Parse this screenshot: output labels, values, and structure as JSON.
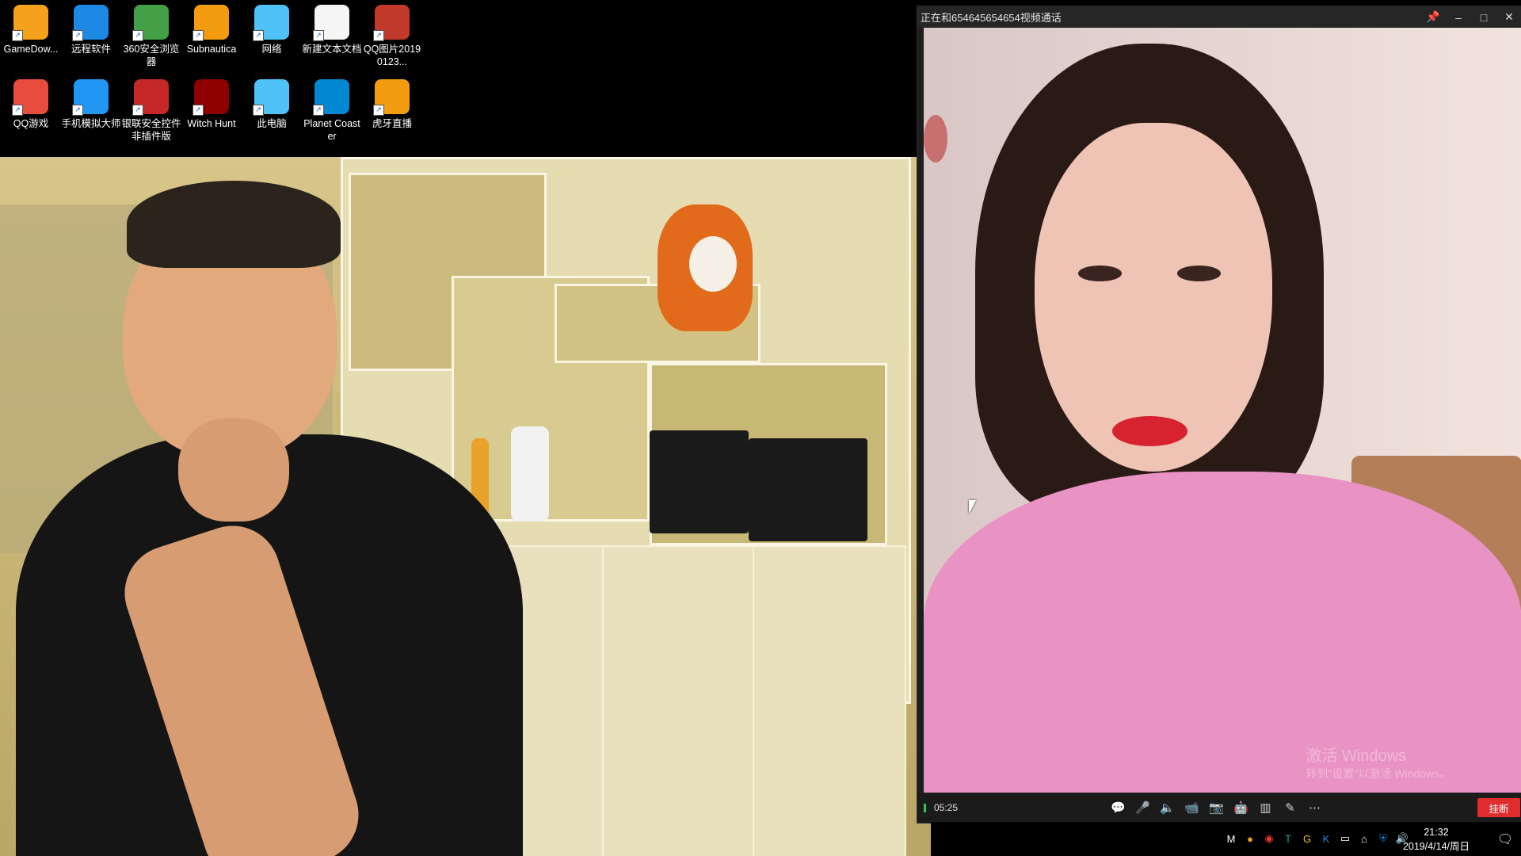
{
  "desktop": {
    "icons_row1": [
      {
        "label": "GameDow...",
        "icon": "gamedownload-icon",
        "color": "#f4a11c"
      },
      {
        "label": "远程软件",
        "icon": "teamviewer-icon",
        "color": "#1e88e5"
      },
      {
        "label": "360安全浏览器",
        "icon": "360-browser-icon",
        "color": "#43a047"
      },
      {
        "label": "Subnautica",
        "icon": "subnautica-icon",
        "color": "#f39c12"
      },
      {
        "label": "网络",
        "icon": "network-globe-icon",
        "color": "#4fc3f7"
      },
      {
        "label": "新建文本文档",
        "icon": "text-document-icon",
        "color": "#f5f5f5"
      },
      {
        "label": "QQ图片20190123...",
        "icon": "qq-image-icon",
        "color": "#c0392b"
      }
    ],
    "icons_row2": [
      {
        "label": "QQ游戏",
        "icon": "qq-game-icon",
        "color": "#e74c3c"
      },
      {
        "label": "手机模拟大师",
        "icon": "phone-emulator-icon",
        "color": "#2196f3"
      },
      {
        "label": "银联安全控件非插件版",
        "icon": "unionpay-shield-icon",
        "color": "#c62828"
      },
      {
        "label": "Witch Hunt",
        "icon": "witch-hunt-icon",
        "color": "#8e0000"
      },
      {
        "label": "此电脑",
        "icon": "this-pc-icon",
        "color": "#4fc3f7"
      },
      {
        "label": "Planet Coaster",
        "icon": "planet-coaster-icon",
        "color": "#0288d1"
      },
      {
        "label": "虎牙直播",
        "icon": "huya-live-icon",
        "color": "#f39c12"
      }
    ]
  },
  "call_window": {
    "title": "正在和6546456546​54视频通话",
    "title_plain": "正在和6546456546​54视频通话",
    "titlebar_icons": [
      "pin-icon",
      "minimize-icon",
      "maximize-icon",
      "close-icon"
    ],
    "titlebar_glyphs": [
      "📌",
      "–",
      "□",
      "✕"
    ],
    "timer": "05:25",
    "controls": [
      {
        "name": "chat-icon",
        "glyph": "💬"
      },
      {
        "name": "microphone-icon",
        "glyph": "🎤"
      },
      {
        "name": "speaker-icon",
        "glyph": "🔈"
      },
      {
        "name": "camera-toggle-icon",
        "glyph": "📹"
      },
      {
        "name": "screenshot-icon",
        "glyph": "📷"
      },
      {
        "name": "effects-icon",
        "glyph": "🤖"
      },
      {
        "name": "layout-icon",
        "glyph": "▥"
      },
      {
        "name": "whiteboard-icon",
        "glyph": "✎"
      },
      {
        "name": "more-icon",
        "glyph": "⋯"
      }
    ],
    "hangup_label": "挂断",
    "watermark_title": "激活 Windows",
    "watermark_sub": "转到\"设置\"以激活 Windows。"
  },
  "taskbar": {
    "tray_icons": [
      {
        "name": "gmail-icon",
        "glyph": "M",
        "color": "#ffffff"
      },
      {
        "name": "game-icon",
        "glyph": "●",
        "color": "#f4a11c"
      },
      {
        "name": "chrome-icon",
        "glyph": "◉",
        "color": "#e53935"
      },
      {
        "name": "tm-icon",
        "glyph": "T",
        "color": "#26a69a"
      },
      {
        "name": "g-icon",
        "glyph": "G",
        "color": "#fbc02d"
      },
      {
        "name": "k-icon",
        "glyph": "K",
        "color": "#1e88e5"
      },
      {
        "name": "display-icon",
        "glyph": "▭",
        "color": "#ffffff"
      },
      {
        "name": "network-icon",
        "glyph": "⌂",
        "color": "#ffffff"
      },
      {
        "name": "security-icon",
        "glyph": "⛨",
        "color": "#1976d2"
      },
      {
        "name": "volume-icon",
        "glyph": "🔊",
        "color": "#ffffff"
      }
    ],
    "time": "21:32",
    "date": "2019/4/14/周日",
    "notification_glyph": "🗨"
  }
}
